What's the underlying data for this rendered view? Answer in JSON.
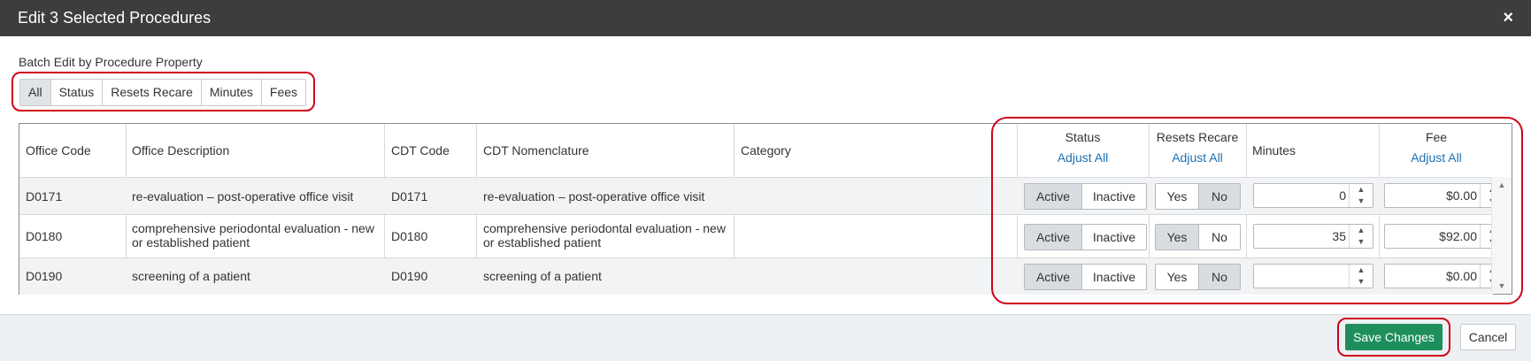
{
  "dialog": {
    "title": "Edit 3 Selected Procedures",
    "close_icon": "×"
  },
  "batch": {
    "label": "Batch Edit by Procedure Property",
    "filters": [
      "All",
      "Status",
      "Resets Recare",
      "Minutes",
      "Fees"
    ],
    "active_filter": "All"
  },
  "table": {
    "headers": {
      "office_code": "Office Code",
      "office_description": "Office Description",
      "cdt_code": "CDT Code",
      "cdt_nomenclature": "CDT Nomenclature",
      "category": "Category",
      "status": "Status",
      "resets_recare": "Resets Recare",
      "minutes": "Minutes",
      "fee": "Fee",
      "adjust_all": "Adjust All"
    },
    "status_options": [
      "Active",
      "Inactive"
    ],
    "recare_options": [
      "Yes",
      "No"
    ],
    "rows": [
      {
        "office_code": "D0171",
        "office_description": "re-evaluation – post-operative office visit",
        "cdt_code": "D0171",
        "cdt_nomenclature": "re-evaluation – post-operative office visit",
        "category": "",
        "status": "Active",
        "resets_recare": "No",
        "minutes": "0",
        "fee": "$0.00"
      },
      {
        "office_code": "D0180",
        "office_description": "comprehensive periodontal evaluation - new or established patient",
        "cdt_code": "D0180",
        "cdt_nomenclature": "comprehensive periodontal evaluation - new or established patient",
        "category": "",
        "status": "Active",
        "resets_recare": "Yes",
        "minutes": "35",
        "fee": "$92.00"
      },
      {
        "office_code": "D0190",
        "office_description": "screening of a patient",
        "cdt_code": "D0190",
        "cdt_nomenclature": "screening of a patient",
        "category": "",
        "status": "Active",
        "resets_recare": "No",
        "minutes": "",
        "fee": "$0.00"
      }
    ]
  },
  "footer": {
    "save_label": "Save Changes",
    "cancel_label": "Cancel"
  },
  "colors": {
    "title_bg": "#3d3d3d",
    "save_bg": "#1e8f5c",
    "highlight": "#d0021b",
    "link": "#1f6fb0"
  }
}
